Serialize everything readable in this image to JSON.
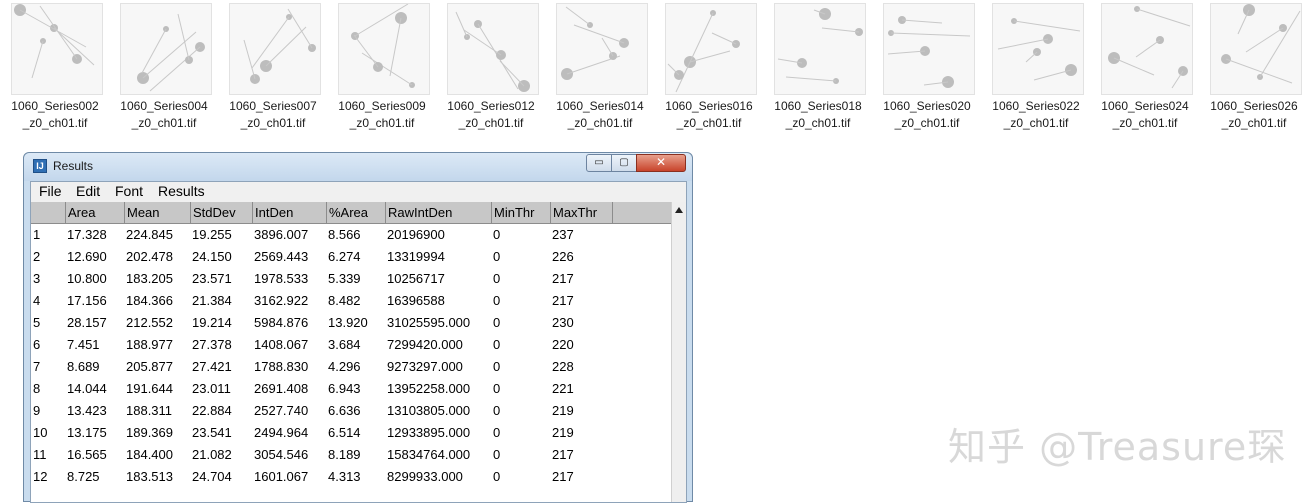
{
  "thumbnails": [
    {
      "line1": "1060_Series002",
      "line2": "_z0_ch01.tif"
    },
    {
      "line1": "1060_Series004",
      "line2": "_z0_ch01.tif"
    },
    {
      "line1": "1060_Series007",
      "line2": "_z0_ch01.tif"
    },
    {
      "line1": "1060_Series009",
      "line2": "_z0_ch01.tif"
    },
    {
      "line1": "1060_Series012",
      "line2": "_z0_ch01.tif"
    },
    {
      "line1": "1060_Series014",
      "line2": "_z0_ch01.tif"
    },
    {
      "line1": "1060_Series016",
      "line2": "_z0_ch01.tif"
    },
    {
      "line1": "1060_Series018",
      "line2": "_z0_ch01.tif"
    },
    {
      "line1": "1060_Series020",
      "line2": "_z0_ch01.tif"
    },
    {
      "line1": "1060_Series022",
      "line2": "_z0_ch01.tif"
    },
    {
      "line1": "1060_Series024",
      "line2": "_z0_ch01.tif"
    },
    {
      "line1": "1060_Series026",
      "line2": "_z0_ch01.tif"
    }
  ],
  "window": {
    "title": "Results",
    "app_icon": "imagej-icon",
    "app_icon_glyph": "IJ",
    "min_glyph": "▭",
    "max_glyph": "▢",
    "close_glyph": "✕"
  },
  "menu": [
    "File",
    "Edit",
    "Font",
    "Results"
  ],
  "table": {
    "columns": [
      "",
      "Area",
      "Mean",
      "StdDev",
      "IntDen",
      "%Area",
      "RawIntDen",
      "MinThr",
      "MaxThr"
    ],
    "rows": [
      [
        "1",
        "17.328",
        "224.845",
        "19.255",
        "3896.007",
        "8.566",
        "20196900",
        "0",
        "237"
      ],
      [
        "2",
        "12.690",
        "202.478",
        "24.150",
        "2569.443",
        "6.274",
        "13319994",
        "0",
        "226"
      ],
      [
        "3",
        "10.800",
        "183.205",
        "23.571",
        "1978.533",
        "5.339",
        "10256717",
        "0",
        "217"
      ],
      [
        "4",
        "17.156",
        "184.366",
        "21.384",
        "3162.922",
        "8.482",
        "16396588",
        "0",
        "217"
      ],
      [
        "5",
        "28.157",
        "212.552",
        "19.214",
        "5984.876",
        "13.920",
        "31025595.000",
        "0",
        "230"
      ],
      [
        "6",
        "7.451",
        "188.977",
        "27.378",
        "1408.067",
        "3.684",
        "7299420.000",
        "0",
        "220"
      ],
      [
        "7",
        "8.689",
        "205.877",
        "27.421",
        "1788.830",
        "4.296",
        "9273297.000",
        "0",
        "228"
      ],
      [
        "8",
        "14.044",
        "191.644",
        "23.011",
        "2691.408",
        "6.943",
        "13952258.000",
        "0",
        "221"
      ],
      [
        "9",
        "13.423",
        "188.311",
        "22.884",
        "2527.740",
        "6.636",
        "13103805.000",
        "0",
        "219"
      ],
      [
        "10",
        "13.175",
        "189.369",
        "23.541",
        "2494.964",
        "6.514",
        "12933895.000",
        "0",
        "219"
      ],
      [
        "11",
        "16.565",
        "184.400",
        "21.082",
        "3054.546",
        "8.189",
        "15834764.000",
        "0",
        "217"
      ],
      [
        "12",
        "8.725",
        "183.513",
        "24.704",
        "1601.067",
        "4.313",
        "8299933.000",
        "0",
        "217"
      ]
    ]
  },
  "watermark": "知乎 @Treasure琛"
}
